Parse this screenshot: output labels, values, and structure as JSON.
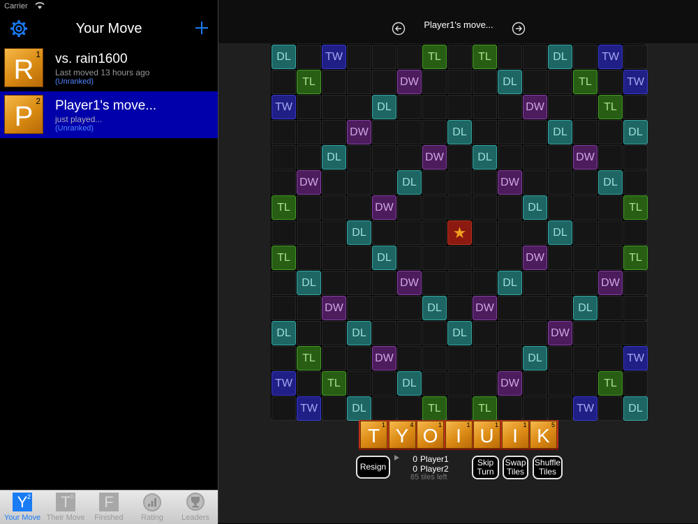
{
  "status_bar": {
    "carrier": "Carrier"
  },
  "sidebar": {
    "title": "Your Move",
    "games": [
      {
        "letter": "R",
        "number": "1",
        "opponent": "vs. rain1600",
        "subtitle": "Last moved 13 hours ago",
        "rank": "(Unranked)",
        "selected": false
      },
      {
        "letter": "P",
        "number": "2",
        "opponent": "Player1's move...",
        "subtitle": "just played...",
        "rank": "(Unranked)",
        "selected": true
      }
    ]
  },
  "tabs": [
    {
      "label": "Your Move",
      "glyph": "Y",
      "badge": "2",
      "active": true
    },
    {
      "label": "Their Move",
      "glyph": "T",
      "badge": "0",
      "active": false
    },
    {
      "label": "Finished",
      "glyph": "F",
      "badge": "",
      "active": false
    },
    {
      "label": "Rating",
      "icon": "gauge-icon",
      "active": false
    },
    {
      "label": "Leaders",
      "icon": "trophy-icon",
      "active": false
    }
  ],
  "header": {
    "move_title": "Player1's move..."
  },
  "board": {
    "size": 15,
    "rows": [
      "DL,,TW,,,,TL,,TL,,,DL,,TW,",
      ",TL,,,,DW,,,,DL,,,TL,,TW",
      "TW,,,,DL,,,,,,DW,,,TL,",
      ",,,DW,,,,DL,,,,DL,,,DL",
      ",,DL,,,,DW,,DL,,,,DW,,",
      ",DW,,,,DL,,,,DW,,,,DL,",
      "TL,,,,DW,,,,,,DL,,,,TL",
      ",,,DL,,,,ST,,,,DL,,,",
      "TL,,,,DL,,,,,,DW,,,,TL",
      ",DL,,,,DW,,,,DL,,,,DW,",
      ",,DW,,,,DL,,DW,,,,DL,,",
      "DL,,,DL,,,,DL,,,,DW,,,",
      ",TL,,,DW,,,,,,DL,,,,TW",
      "TW,,TL,,,DL,,,,DW,,,,TL,",
      ",TW,,DL,,,TL,,TL,,,,TW,,DL"
    ]
  },
  "rack": [
    {
      "letter": "T",
      "points": "1"
    },
    {
      "letter": "Y",
      "points": "4"
    },
    {
      "letter": "O",
      "points": "1"
    },
    {
      "letter": "I",
      "points": "1"
    },
    {
      "letter": "U",
      "points": "1"
    },
    {
      "letter": "I",
      "points": "1"
    },
    {
      "letter": "K",
      "points": "5"
    }
  ],
  "controls": {
    "resign": "Resign",
    "skip_1": "Skip",
    "skip_2": "Turn",
    "swap_1": "Swap",
    "swap_2": "Tiles",
    "shuffle_1": "Shuffle",
    "shuffle_2": "Tiles"
  },
  "scores": [
    {
      "points": "0",
      "name": "Player1"
    },
    {
      "points": "0",
      "name": "Player2"
    }
  ],
  "tiles_left": "85 tiles left",
  "colors": {
    "selected_row": "#0000aa",
    "accent": "#1a7cf5",
    "rack_bar": "#c42e1b"
  }
}
